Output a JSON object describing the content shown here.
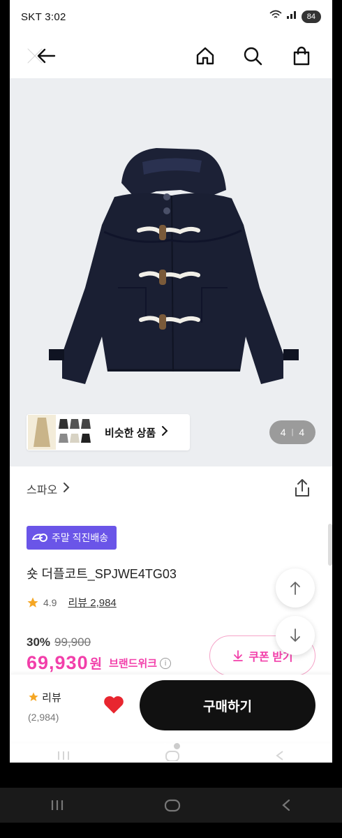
{
  "status_bar": {
    "carrier_time": "SKT 3:02",
    "battery": "84"
  },
  "header": {
    "icons": [
      "close-icon",
      "back-arrow-icon",
      "home-icon",
      "search-icon",
      "shopping-bag-icon"
    ]
  },
  "gallery": {
    "similar_label": "비슷한 상품",
    "counter_current": "4",
    "counter_total": "4",
    "counter_separator": "|"
  },
  "product": {
    "brand": "스파오",
    "badge": "주말 직진배송",
    "name": "숏 더플코트_SPJWE4TG03",
    "rating": "4.9",
    "review_link": "리뷰 2,984",
    "discount": "30%",
    "original_price": "99,900",
    "price": "69,930",
    "currency": "원",
    "event_label": "브랜드위크",
    "info_icon": "i",
    "coupon_label": "쿠폰 받기"
  },
  "bottom_bar": {
    "review_label": "리뷰",
    "review_count": "(2,984)",
    "buy_label": "구매하기"
  },
  "colors": {
    "accent_pink": "#f23faa",
    "badge_purple": "#6a55e8",
    "buy_button": "#111111",
    "heart": "#e8262f",
    "star": "#f5a623"
  }
}
